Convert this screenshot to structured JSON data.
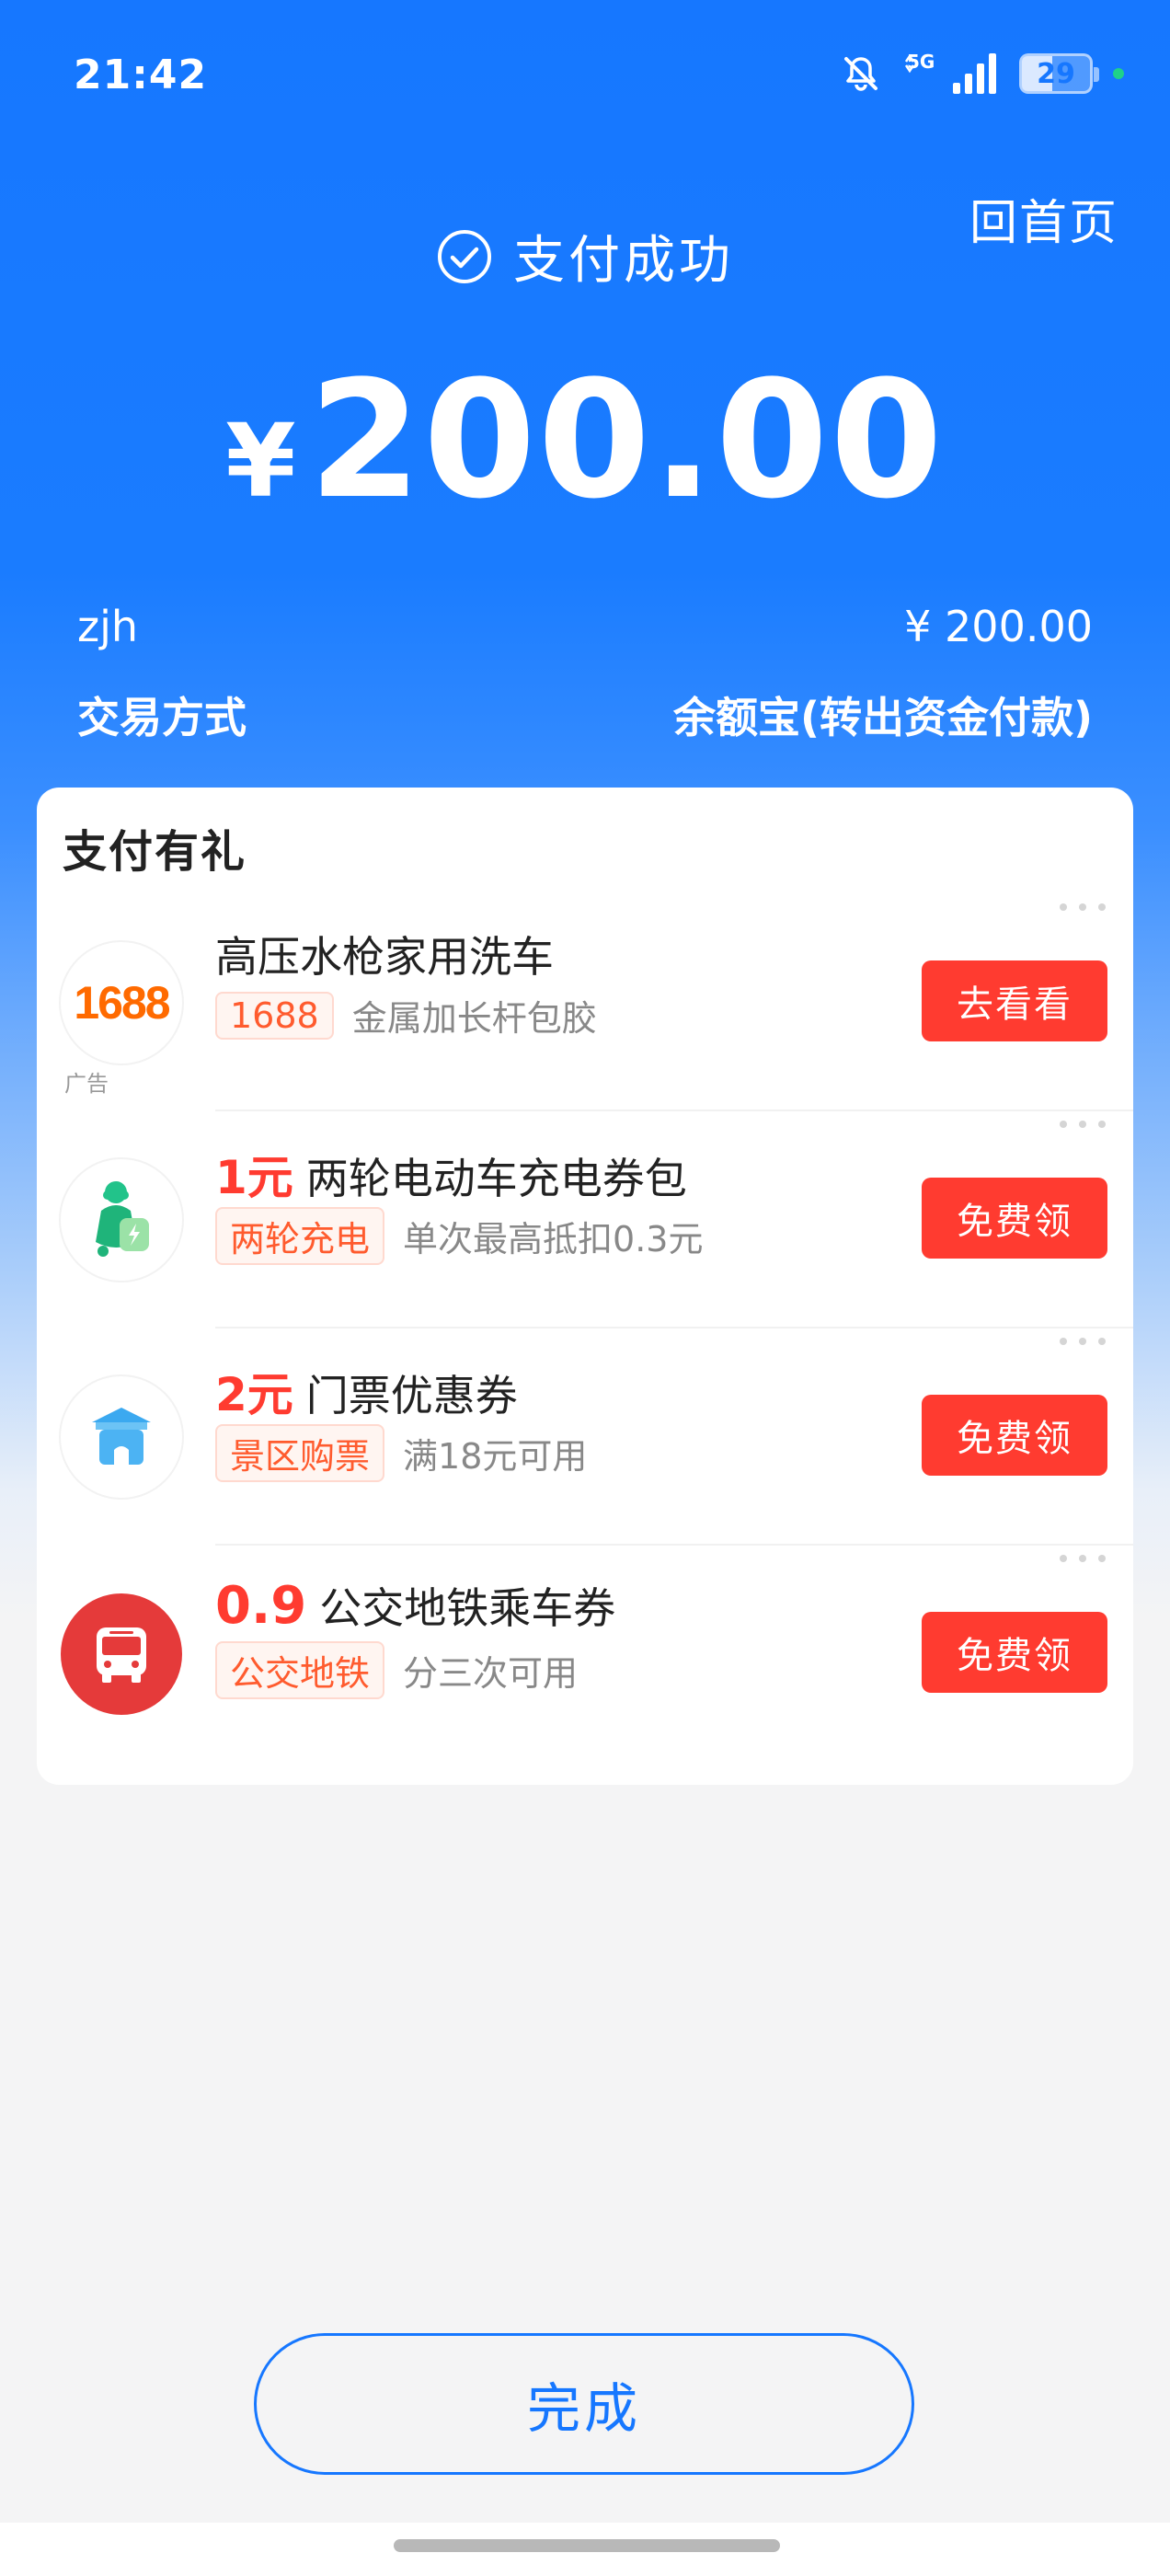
{
  "status_bar": {
    "time": "21:42",
    "network": "5G",
    "battery": "29",
    "icons": [
      "bell-muted-icon",
      "network-5g-icon",
      "signal-icon",
      "battery-icon"
    ]
  },
  "header": {
    "home_link": "回首页",
    "status_text": "支付成功",
    "currency": "¥",
    "amount": "200.00"
  },
  "details": {
    "payee": "zjh",
    "payee_amount": "¥ 200.00",
    "method_label": "交易方式",
    "method_value": "余额宝(转出资金付款)"
  },
  "rewards": {
    "title": "支付有礼",
    "items": [
      {
        "logo": "1688",
        "ad_label": "广告",
        "highlight": "",
        "title": "高压水枪家用洗车",
        "tag": "1688",
        "desc": "金属加长杆包胶",
        "button": "去看看"
      },
      {
        "logo": "scooter-icon",
        "highlight": "1元",
        "title": "两轮电动车充电券包",
        "tag": "两轮充电",
        "desc": "单次最高抵扣0.3元",
        "button": "免费领"
      },
      {
        "logo": "ticket-gate-icon",
        "highlight": "2元",
        "title": "门票优惠券",
        "tag": "景区购票",
        "desc": "满18元可用",
        "button": "免费领"
      },
      {
        "logo": "bus-icon",
        "highlight": "0.9",
        "title": "公交地铁乘车券",
        "tag": "公交地铁",
        "desc": "分三次可用",
        "button": "免费领"
      }
    ]
  },
  "footer": {
    "done_button": "完成"
  },
  "colors": {
    "primary_blue": "#1677ff",
    "accent_red": "#ff3b30",
    "tag_orange": "#ff5b2e"
  }
}
